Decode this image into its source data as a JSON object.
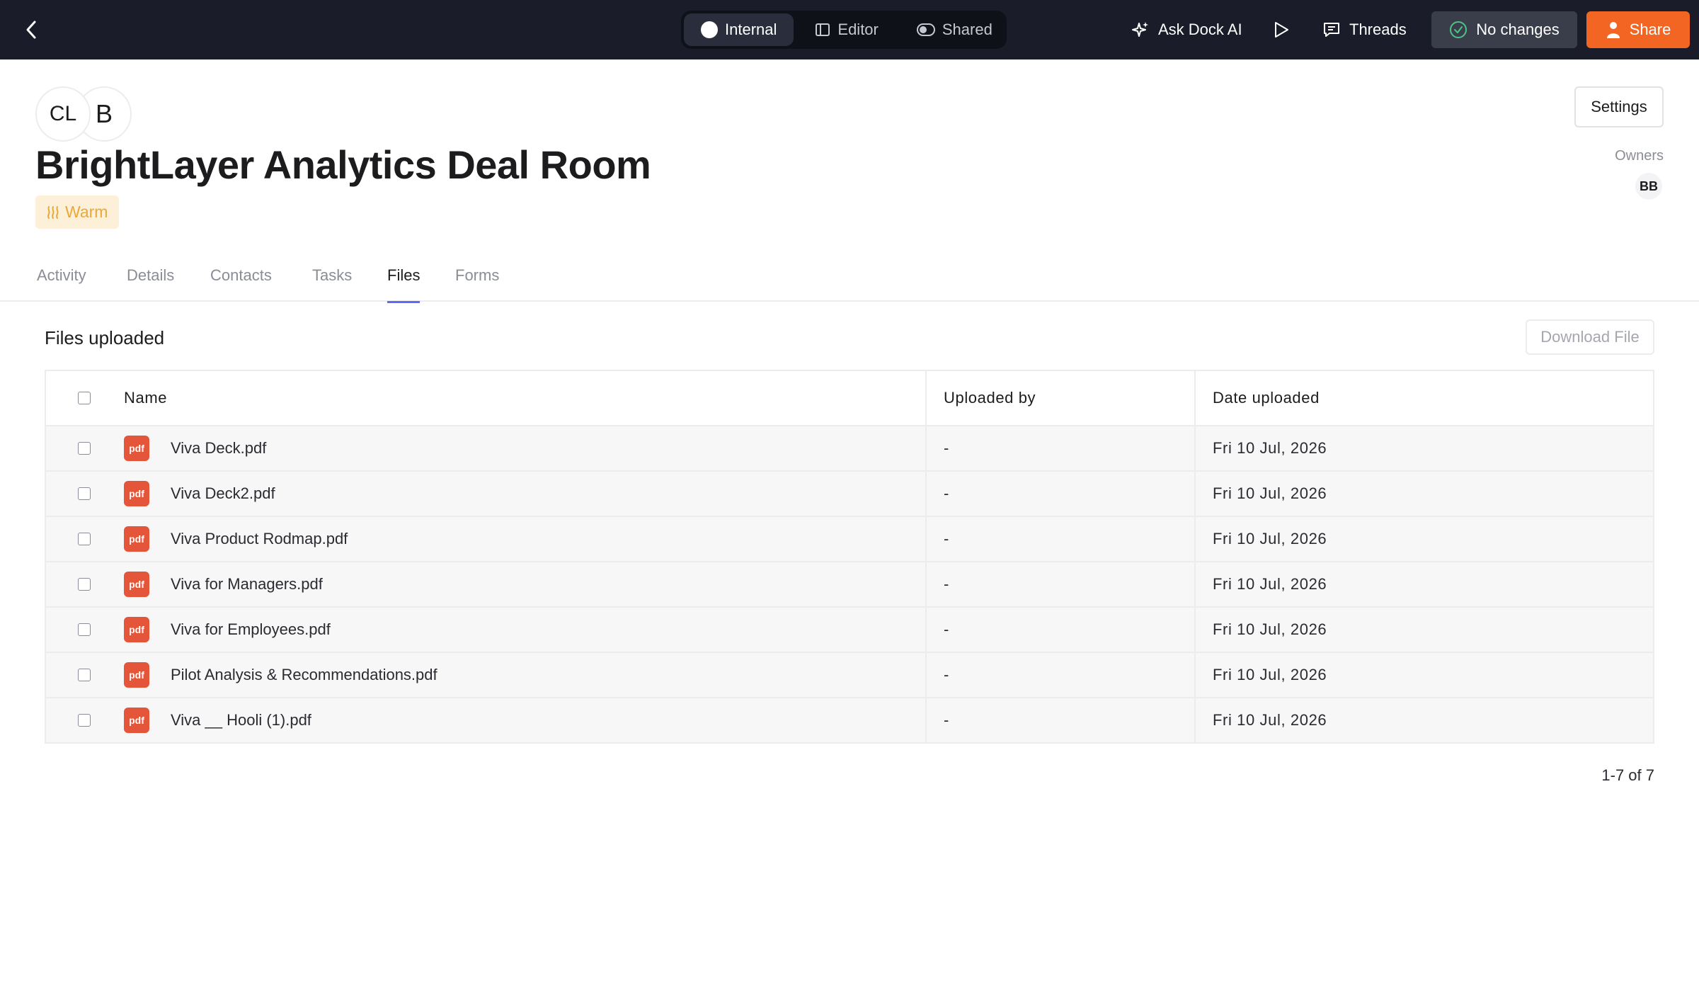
{
  "topbar": {
    "modes": [
      {
        "label": "Internal",
        "active": true
      },
      {
        "label": "Editor",
        "active": false
      },
      {
        "label": "Shared",
        "active": false
      }
    ],
    "ask_ai_label": "Ask Dock AI",
    "threads_label": "Threads",
    "no_changes_label": "No changes",
    "share_label": "Share"
  },
  "header": {
    "avatars": [
      "CL",
      "B"
    ],
    "title": "BrightLayer Analytics Deal Room",
    "status_badge": "Warm",
    "settings_label": "Settings",
    "owners_label": "Owners",
    "owner_initials": "BB"
  },
  "tabs": [
    "Activity",
    "Details",
    "Contacts",
    "Tasks",
    "Files",
    "Forms"
  ],
  "active_tab": "Files",
  "files": {
    "section_title": "Files uploaded",
    "download_label": "Download File",
    "columns": [
      "Name",
      "Uploaded by",
      "Date uploaded"
    ],
    "icon_label": "pdf",
    "rows": [
      {
        "name": "Viva Deck.pdf",
        "uploaded_by": "-",
        "date": "Fri 10 Jul, 2026"
      },
      {
        "name": "Viva Deck2.pdf",
        "uploaded_by": "-",
        "date": "Fri 10 Jul, 2026"
      },
      {
        "name": "Viva Product Rodmap.pdf",
        "uploaded_by": "-",
        "date": "Fri 10 Jul, 2026"
      },
      {
        "name": "Viva for Managers.pdf",
        "uploaded_by": "-",
        "date": "Fri 10 Jul, 2026"
      },
      {
        "name": "Viva for Employees.pdf",
        "uploaded_by": "-",
        "date": "Fri 10 Jul, 2026"
      },
      {
        "name": "Pilot Analysis & Recommendations.pdf",
        "uploaded_by": "-",
        "date": "Fri 10 Jul, 2026"
      },
      {
        "name": "Viva __ Hooli (1).pdf",
        "uploaded_by": "-",
        "date": "Fri 10 Jul, 2026"
      }
    ],
    "pagination": "1-7 of 7"
  },
  "colors": {
    "topbar_bg": "#1a1d29",
    "share_accent": "#f26522",
    "tab_underline": "#5b6cf0",
    "pdf_icon": "#e5553a",
    "warm_badge_bg": "#fdf0d8",
    "warm_badge_text": "#e8a93a"
  }
}
